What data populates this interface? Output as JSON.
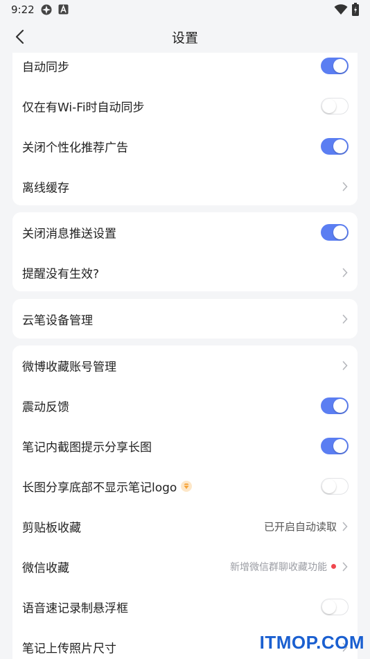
{
  "status": {
    "time": "9:22"
  },
  "header": {
    "title": "设置"
  },
  "cards": [
    {
      "rows": [
        {
          "label": "自动同步",
          "control": "toggle",
          "on": true
        },
        {
          "label": "仅在有Wi-Fi时自动同步",
          "control": "toggle",
          "on": false
        },
        {
          "label": "关闭个性化推荐广告",
          "control": "toggle",
          "on": true
        },
        {
          "label": "离线缓存",
          "control": "chevron"
        }
      ]
    },
    {
      "rows": [
        {
          "label": "关闭消息推送设置",
          "control": "toggle",
          "on": true
        },
        {
          "label": "提醒没有生效?",
          "control": "chevron"
        }
      ]
    },
    {
      "rows": [
        {
          "label": "云笔设备管理",
          "control": "chevron"
        }
      ]
    },
    {
      "rows": [
        {
          "label": "微博收藏账号管理",
          "control": "chevron"
        },
        {
          "label": "震动反馈",
          "control": "toggle",
          "on": true
        },
        {
          "label": "笔记内截图提示分享长图",
          "control": "toggle",
          "on": true
        },
        {
          "label": "长图分享底部不显示笔记logo",
          "control": "toggle",
          "on": false,
          "badge": "vip-diamond-icon"
        },
        {
          "label": "剪贴板收藏",
          "control": "chevron",
          "value": "已开启自动读取"
        },
        {
          "label": "微信收藏",
          "control": "chevron",
          "value": "新增微信群聊收藏功能",
          "dot": true
        },
        {
          "label": "语音速记录制悬浮框",
          "control": "toggle",
          "on": false
        },
        {
          "label": "笔记上传照片尺寸",
          "control": "chevron"
        }
      ]
    }
  ],
  "watermark": "ITMOP.COM",
  "colors": {
    "accent": "#5b7ef2",
    "background": "#f4f5f7",
    "card": "#ffffff",
    "dot": "#f0474e",
    "vip": "#f6a43a"
  }
}
